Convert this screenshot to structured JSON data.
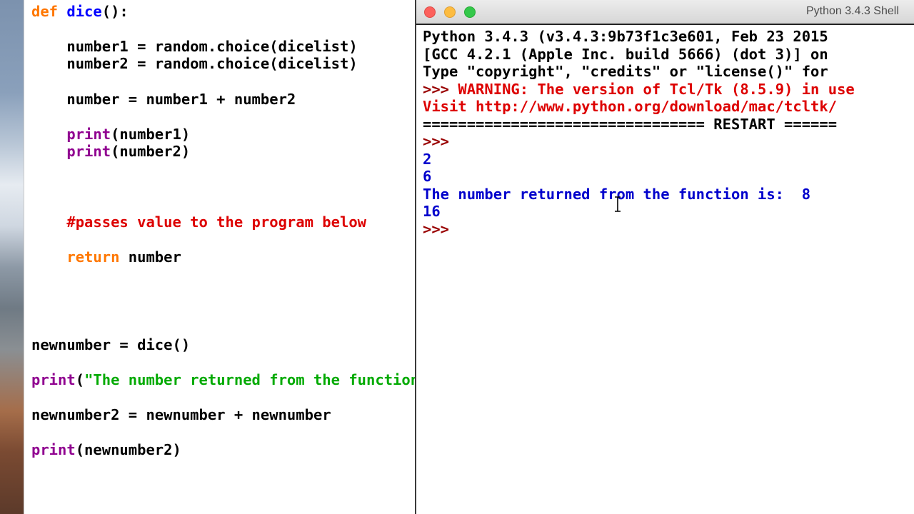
{
  "editor": {
    "lines": [
      {
        "a": "def",
        "b": " ",
        "c": "dice",
        "d": "():"
      },
      {
        "a": "    number1 = random.choice(dicelist)"
      },
      {
        "a": "    number2 = random.choice(dicelist)"
      },
      {
        "a": "    number = number1 + number2"
      },
      {
        "a": "    ",
        "b": "print",
        "c": "(number1)"
      },
      {
        "a": "    ",
        "b": "print",
        "c": "(number2)"
      },
      {
        "a": "    #passes value to the program below"
      },
      {
        "a": "    ",
        "b": "return",
        "c": " number"
      },
      {
        "a": "newnumber = dice()"
      },
      {
        "a": "print",
        "b": "(",
        "c": "\"The number returned from the function is: \", newnumber)"
      },
      {
        "a": "newnumber2 = newnumber + newnumber"
      },
      {
        "a": "print",
        "b": "(newnumber2)"
      }
    ]
  },
  "shell": {
    "window_title": "Python 3.4.3 Shell",
    "banner1": "Python 3.4.3 (v3.4.3:9b73f1c3e601, Feb 23 2015",
    "banner2": "[GCC 4.2.1 (Apple Inc. build 5666) (dot 3)] on",
    "banner3": "Type \"copyright\", \"credits\" or \"license()\" for",
    "warning_prompt": ">>> ",
    "warning_text": "WARNING: The version of Tcl/Tk (8.5.9) in use",
    "visit_text": "Visit http://www.python.org/download/mac/tcltk/",
    "restart_line": "================================ RESTART ======",
    "prompt": ">>>",
    "outputs": [
      "2",
      "6",
      "The number returned from the function is:  8",
      "16"
    ],
    "final_prompt": ">>>"
  }
}
